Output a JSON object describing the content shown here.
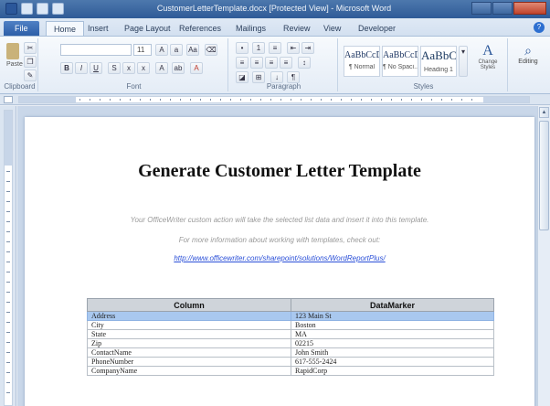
{
  "window": {
    "title": "CustomerLetterTemplate.docx [Protected View] - Microsoft Word"
  },
  "ribbon_tabs": [
    {
      "label": "File"
    },
    {
      "label": "Home"
    },
    {
      "label": "Insert"
    },
    {
      "label": "Page Layout"
    },
    {
      "label": "References"
    },
    {
      "label": "Mailings"
    },
    {
      "label": "Review"
    },
    {
      "label": "View"
    },
    {
      "label": "Developer"
    }
  ],
  "ribbon": {
    "clipboard": {
      "paste_label": "Paste",
      "group_label": "Clipboard"
    },
    "font": {
      "size_value": "11",
      "group_label": "Font"
    },
    "paragraph": {
      "group_label": "Paragraph"
    },
    "styles": {
      "group_label": "Styles",
      "items": [
        {
          "sample": "AaBbCcDc",
          "name": "¶ Normal"
        },
        {
          "sample": "AaBbCcDc",
          "name": "¶ No Spaci..."
        },
        {
          "sample": "AaBbC",
          "name": "Heading 1"
        }
      ],
      "change_styles_label": "Change Styles"
    },
    "editing": {
      "label": "Editing"
    }
  },
  "document": {
    "title": "Generate Customer Letter Template",
    "description": "Your OfficeWriter custom action will take the selected list data and insert it into this template.",
    "more_info": "For more information about working with templates, check out:",
    "link": "http://www.officewriter.com/sharepoint/solutions/WordReportPlus/",
    "table": {
      "headers": [
        "Column",
        "DataMarker"
      ],
      "rows": [
        [
          "Address",
          "123 Main St"
        ],
        [
          "City",
          "Boston"
        ],
        [
          "State",
          "MA"
        ],
        [
          "Zip",
          "02215"
        ],
        [
          "ContactName",
          "John Smith"
        ],
        [
          "PhoneNumber",
          "617-555-2424"
        ],
        [
          "CompanyName",
          "RapidCorp"
        ]
      ],
      "selected_row": 0
    }
  },
  "colors": {
    "title_bar": "#2f5b97",
    "file_tab": "#2d5fa8",
    "selection": "#a9c8ef",
    "link": "#2a4fd8"
  }
}
